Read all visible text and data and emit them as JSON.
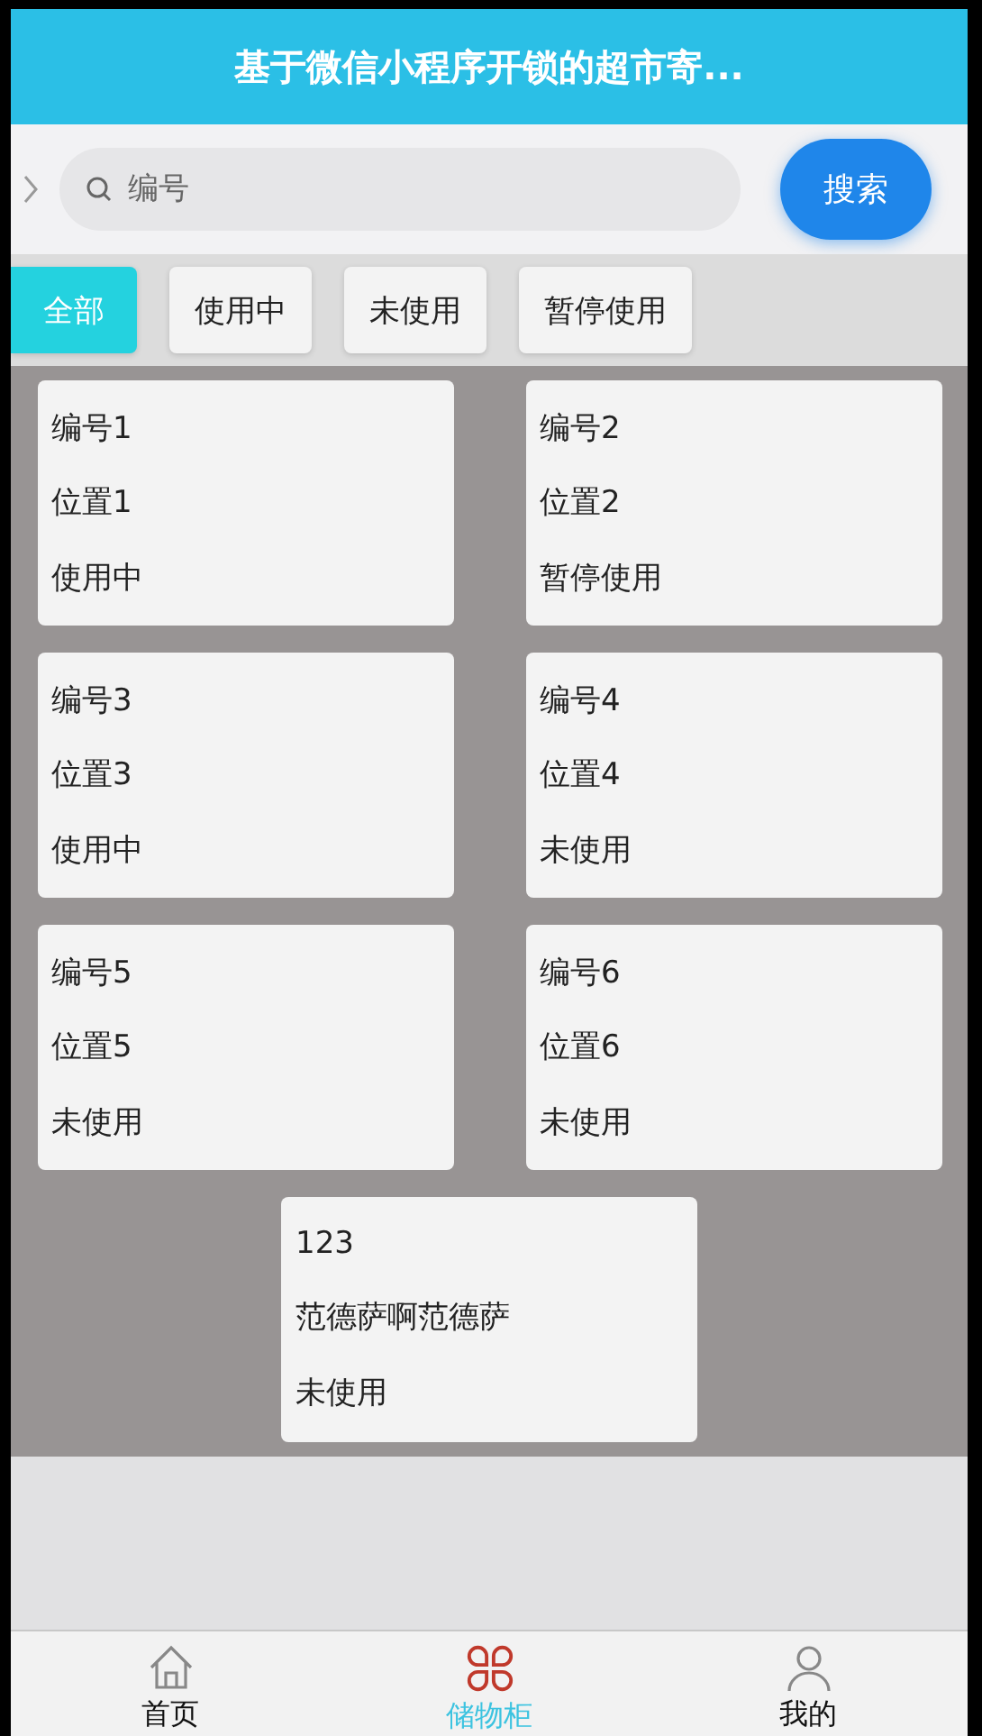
{
  "header": {
    "title": "基于微信小程序开锁的超市寄..."
  },
  "search": {
    "placeholder": "编号",
    "button": "搜索"
  },
  "filters": [
    {
      "label": "全部",
      "selected": true
    },
    {
      "label": "使用中",
      "selected": false
    },
    {
      "label": "未使用",
      "selected": false
    },
    {
      "label": "暂停使用",
      "selected": false
    }
  ],
  "lockers": [
    {
      "number": "编号1",
      "location": "位置1",
      "status": "使用中"
    },
    {
      "number": "编号2",
      "location": "位置2",
      "status": "暂停使用"
    },
    {
      "number": "编号3",
      "location": "位置3",
      "status": "使用中"
    },
    {
      "number": "编号4",
      "location": "位置4",
      "status": "未使用"
    },
    {
      "number": "编号5",
      "location": "位置5",
      "status": "未使用"
    },
    {
      "number": "编号6",
      "location": "位置6",
      "status": "未使用"
    },
    {
      "number": "123",
      "location": "范德萨啊范德萨",
      "status": "未使用"
    }
  ],
  "tab_bar": [
    {
      "label": "首页",
      "kind": "home",
      "selected": false
    },
    {
      "label": "储物柜",
      "kind": "locker",
      "selected": true
    },
    {
      "label": "我的",
      "kind": "user",
      "selected": false
    }
  ]
}
